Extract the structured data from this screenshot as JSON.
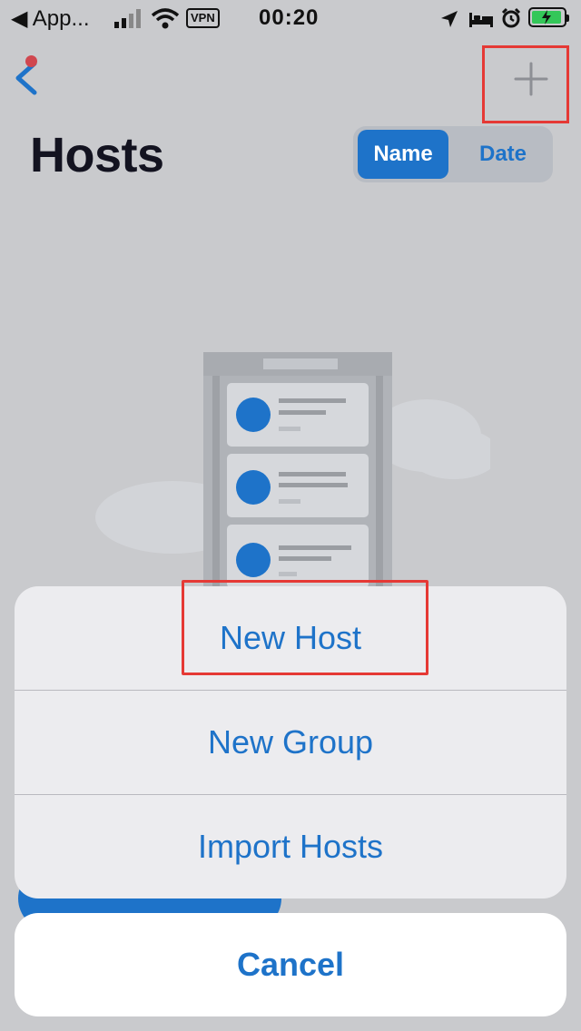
{
  "status_bar": {
    "back_app_label": "◀ App...",
    "vpn_label": "VPN",
    "time": "00:20"
  },
  "nav": {
    "title": "Hosts",
    "sort_options": [
      "Name",
      "Date"
    ],
    "selected_sort": "Name"
  },
  "action_sheet": {
    "items": [
      "New Host",
      "New Group",
      "Import Hosts"
    ],
    "cancel_label": "Cancel"
  },
  "colors": {
    "accent": "#1e73c9",
    "highlight": "#e53935",
    "background": "#c9cacd",
    "battery": "#34c759"
  },
  "icons": {
    "back": "chevron-left-icon",
    "add": "plus-icon",
    "location": "location-arrow-icon",
    "bed": "bed-icon",
    "alarm": "alarm-icon",
    "wifi": "wifi-icon",
    "signal": "signal-icon",
    "battery": "battery-charging-icon"
  }
}
